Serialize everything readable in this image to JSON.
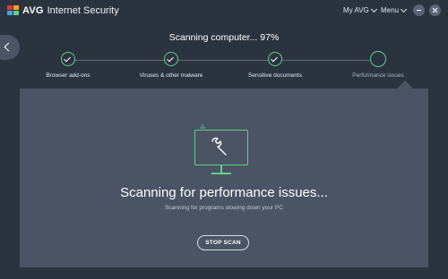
{
  "app": {
    "brand": "AVG",
    "product": "Internet Security"
  },
  "header": {
    "my_avg": "My AVG",
    "menu": "Menu"
  },
  "scan": {
    "title": "Scanning computer... 97%",
    "progress_percent": 97
  },
  "steps": [
    {
      "label": "Browser add-ons",
      "status": "done"
    },
    {
      "label": "Viruses & other malware",
      "status": "done"
    },
    {
      "label": "Sensitive documents",
      "status": "done"
    },
    {
      "label": "Performance issues",
      "status": "in-progress"
    }
  ],
  "panel": {
    "heading": "Scanning for performance issues...",
    "subheading": "Scanning for programs slowing down your PC",
    "stop_button": "STOP SCAN"
  },
  "colors": {
    "background": "#2b333f",
    "panel": "#4a5465",
    "accent_green": "#5fd186"
  },
  "icons": {
    "back": "chevron-left-icon",
    "minimize": "minimize-icon",
    "close": "close-icon",
    "step_done": "checkmark-icon",
    "performance": "monitor-wrench-icon"
  }
}
